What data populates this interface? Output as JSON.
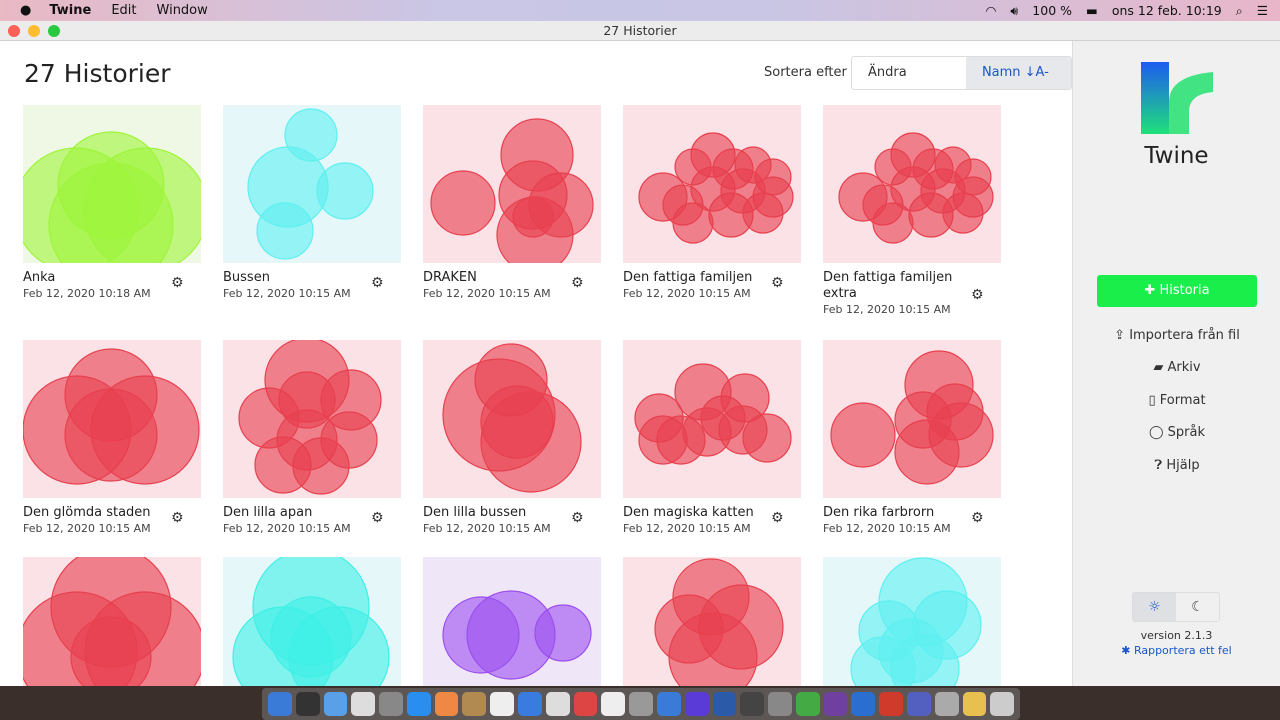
{
  "menubar": {
    "app": "Twine",
    "items": [
      "Edit",
      "Window"
    ],
    "battery": "100 %",
    "clock": "ons 12 feb.  10:19"
  },
  "window": {
    "title": "27 Historier"
  },
  "main": {
    "title": "27 Historier",
    "sort_label": "Sortera efter",
    "sort_options": [
      "Ändra datum",
      "Namn ↓A-Z"
    ],
    "stories": [
      {
        "name": "Anka",
        "date": "Feb 12, 2020 10:18 AM",
        "color": "#9ef53a",
        "bg": "#eff8e4"
      },
      {
        "name": "Bussen",
        "date": "Feb 12, 2020 10:15 AM",
        "color": "#5ef0f0",
        "bg": "#e6f7fa"
      },
      {
        "name": "DRAKEN",
        "date": "Feb 12, 2020 10:15 AM",
        "color": "#e8404e",
        "bg": "#fae2e6"
      },
      {
        "name": "Den fattiga familjen",
        "date": "Feb 12, 2020 10:15 AM",
        "color": "#e8404e",
        "bg": "#fae2e6"
      },
      {
        "name": "Den fattiga familjen extra",
        "date": "Feb 12, 2020 10:15 AM",
        "color": "#e8404e",
        "bg": "#fae2e6"
      },
      {
        "name": "Den glömda staden",
        "date": "Feb 12, 2020 10:15 AM",
        "color": "#e8404e",
        "bg": "#fae2e6"
      },
      {
        "name": "Den lilla apan",
        "date": "Feb 12, 2020 10:15 AM",
        "color": "#e8404e",
        "bg": "#fae2e6"
      },
      {
        "name": "Den lilla bussen",
        "date": "Feb 12, 2020 10:15 AM",
        "color": "#e8404e",
        "bg": "#fae2e6"
      },
      {
        "name": "Den magiska katten",
        "date": "Feb 12, 2020 10:15 AM",
        "color": "#e8404e",
        "bg": "#fae2e6"
      },
      {
        "name": "Den rika farbrorn",
        "date": "Feb 12, 2020 10:15 AM",
        "color": "#e8404e",
        "bg": "#fae2e6"
      },
      {
        "color": "#e8404e",
        "bg": "#fae2e6"
      },
      {
        "color": "#3ef0e6",
        "bg": "#e6f7fa"
      },
      {
        "color": "#9b4ef0",
        "bg": "#efe6f8"
      },
      {
        "color": "#e8404e",
        "bg": "#fae2e6"
      },
      {
        "color": "#5ef0f0",
        "bg": "#e6f7fa"
      }
    ]
  },
  "sidebar": {
    "logo": "Twine",
    "new_story": "Historia",
    "items": [
      "Importera från fil",
      "Arkiv",
      "Format",
      "Språk",
      "Hjälp"
    ],
    "version": "version 2.1.3",
    "report": "Rapportera ett fel"
  }
}
